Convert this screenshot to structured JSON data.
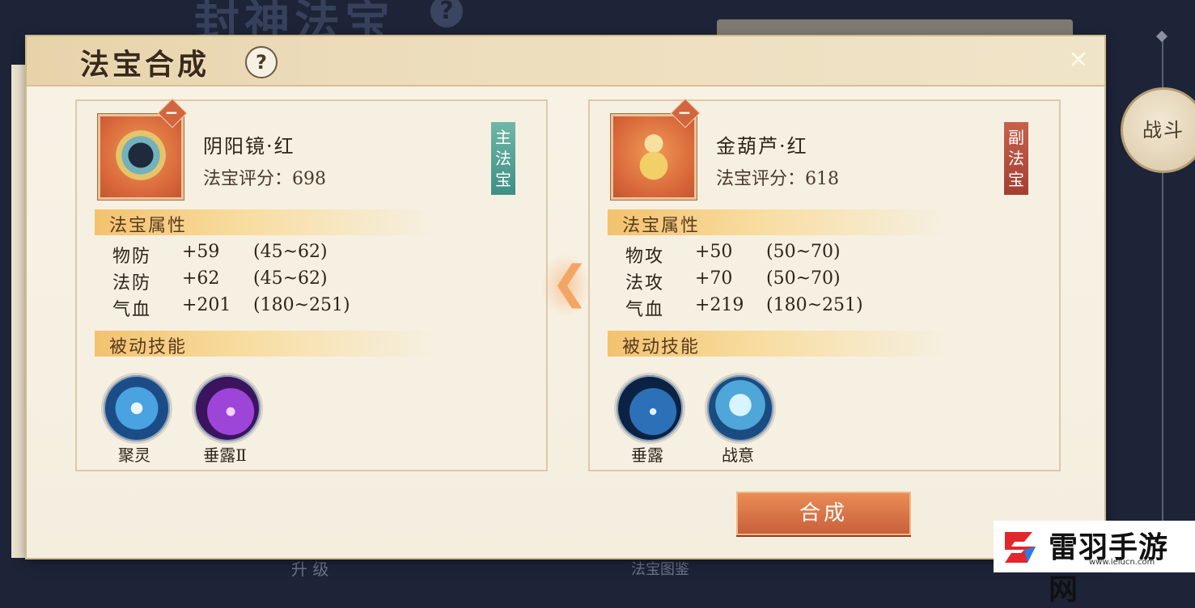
{
  "background": {
    "title": "封神法宝",
    "battle_label": "战斗",
    "bottom_left_text": "升 级",
    "bottom_right_text": "法宝图鉴"
  },
  "dialog": {
    "title": "法宝合成",
    "help_symbol": "?",
    "close_symbol": "✕"
  },
  "main_item": {
    "name": "阴阳镜·红",
    "score_label": "法宝评分：",
    "score": "698",
    "role": "主法宝",
    "badge": "−",
    "attributes_header": "法宝属性",
    "attributes": [
      {
        "name": "物防",
        "value": "+59",
        "range": "(45~62)"
      },
      {
        "name": "法防",
        "value": "+62",
        "range": "(45~62)"
      },
      {
        "name": "气血",
        "value": "+201",
        "range": "(180~251)"
      }
    ],
    "skills_header": "被动技能",
    "skills": [
      {
        "name": "聚灵",
        "icon": "spiral-skill-icon"
      },
      {
        "name": "垂露Ⅱ",
        "icon": "purple-slash-skill-icon"
      }
    ]
  },
  "sub_item": {
    "name": "金葫芦·红",
    "score_label": "法宝评分：",
    "score": "618",
    "role": "副法宝",
    "badge": "−",
    "attributes_header": "法宝属性",
    "attributes": [
      {
        "name": "物攻",
        "value": "+50",
        "range": "(50~70)"
      },
      {
        "name": "法攻",
        "value": "+70",
        "range": "(50~70)"
      },
      {
        "name": "气血",
        "value": "+219",
        "range": "(180~251)"
      }
    ],
    "skills_header": "被动技能",
    "skills": [
      {
        "name": "垂露",
        "icon": "blue-slash-skill-icon"
      },
      {
        "name": "战意",
        "icon": "fists-skill-icon"
      }
    ]
  },
  "merge_arrow": "❮",
  "merge_button": "合成",
  "watermark": {
    "name": "雷羽手游网",
    "url": "www.leiucn.com"
  }
}
